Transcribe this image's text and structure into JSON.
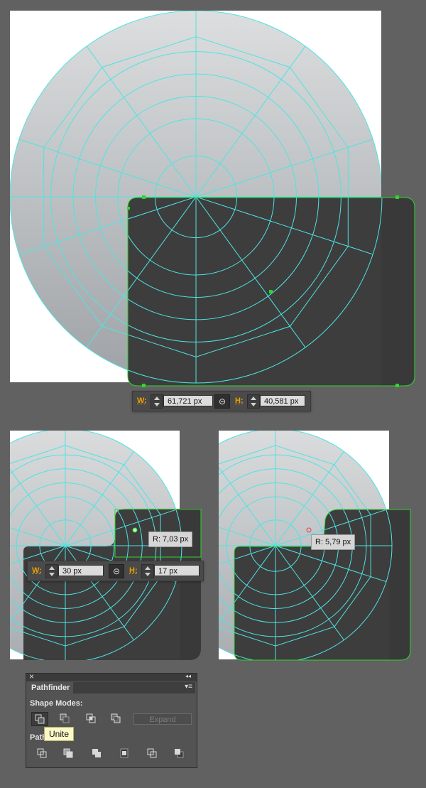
{
  "top_section": {
    "width_label": "W:",
    "width_value": "61,721 px",
    "height_label": "H:",
    "height_value": "40,581 px",
    "link_icon": "chain-link-icon"
  },
  "left_section": {
    "width_label": "W:",
    "width_value": "30 px",
    "height_label": "H:",
    "height_value": "17 px",
    "radius_tooltip": "R: 7,03 px"
  },
  "right_section": {
    "radius_tooltip": "R: 5,79 px"
  },
  "pathfinder": {
    "close_glyph": "×",
    "collapse_glyph": "◂◂",
    "tab_title": "Pathfinder",
    "menu_glyph": "▾≡",
    "shape_modes_label": "Shape Modes:",
    "pathfinders_label": "Path",
    "expand_label": "Expand",
    "tooltip": "Unite",
    "shape_mode_icons": [
      "unite-icon",
      "minus-front-icon",
      "intersect-icon",
      "exclude-icon"
    ],
    "pathfinder_icons": [
      "divide-icon",
      "trim-icon",
      "merge-icon",
      "crop-icon",
      "outline-icon",
      "minus-back-icon"
    ]
  },
  "colors": {
    "background": "#616161",
    "artboard": "#ffffff",
    "dark_shape": "#3d3d3d",
    "guide": "#4fe3e3",
    "selection": "#2fd52f",
    "label_orange": "#f0a000"
  }
}
